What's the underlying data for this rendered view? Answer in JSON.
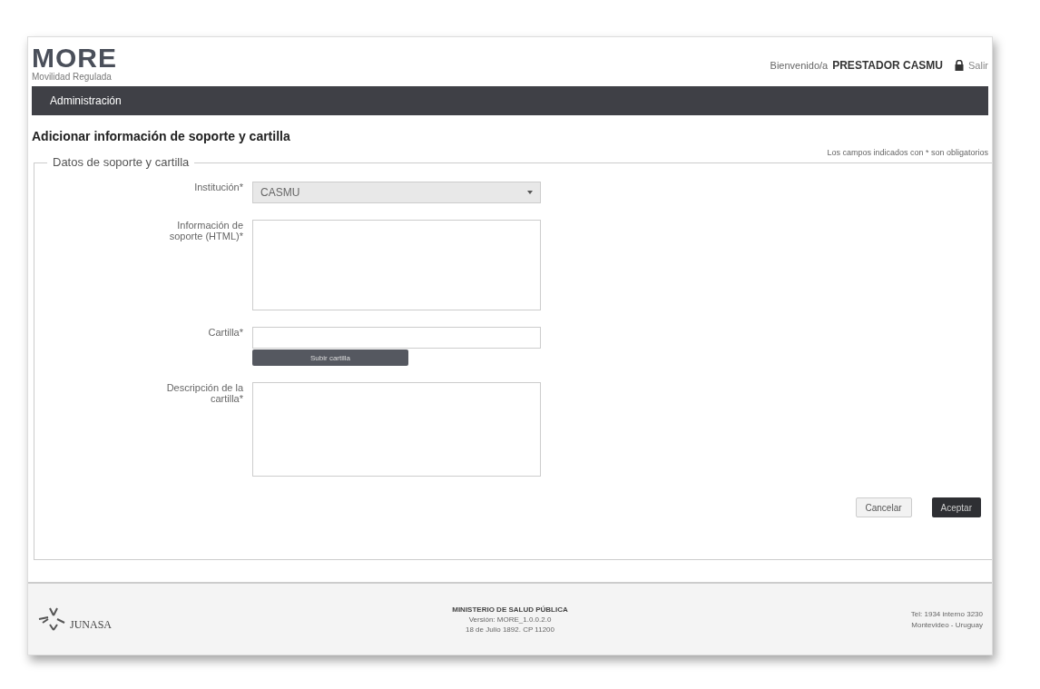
{
  "header": {
    "logo": "MORE",
    "logo_subtitle": "Movilidad Regulada",
    "welcome": "Bienvenido/a",
    "user": "PRESTADOR CASMU",
    "logout": "Salir"
  },
  "nav": {
    "items": [
      {
        "label": "Administración",
        "selected": true
      }
    ]
  },
  "page_title": "Adicionar información de soporte y cartilla",
  "required_note": "Los campos indicados con * son obligatorios",
  "form": {
    "legend": "Datos de soporte y cartilla",
    "fields": [
      {
        "kind": "select",
        "label": "Institución*",
        "value": "CASMU"
      },
      {
        "kind": "textarea",
        "label": "Información de soporte (HTML)*"
      },
      {
        "kind": "file",
        "label": "Cartilla*",
        "button": "Subir cartilla"
      },
      {
        "kind": "textarea",
        "label": "Descripción de la cartilla*"
      }
    ],
    "buttons": [
      {
        "label": "Cancelar",
        "kind": "secondary"
      },
      {
        "label": "Aceptar",
        "kind": "primary"
      }
    ]
  },
  "footer": {
    "logo": "JUNASA",
    "center": [
      "MINISTERIO DE SALUD PÚBLICA",
      "Versión: MORE_1.0.0.2.0",
      "18 de Julio 1892. CP 11200"
    ],
    "right": [
      "Tel: 1934 interno 3230",
      "Montevideo - Uruguay"
    ]
  }
}
